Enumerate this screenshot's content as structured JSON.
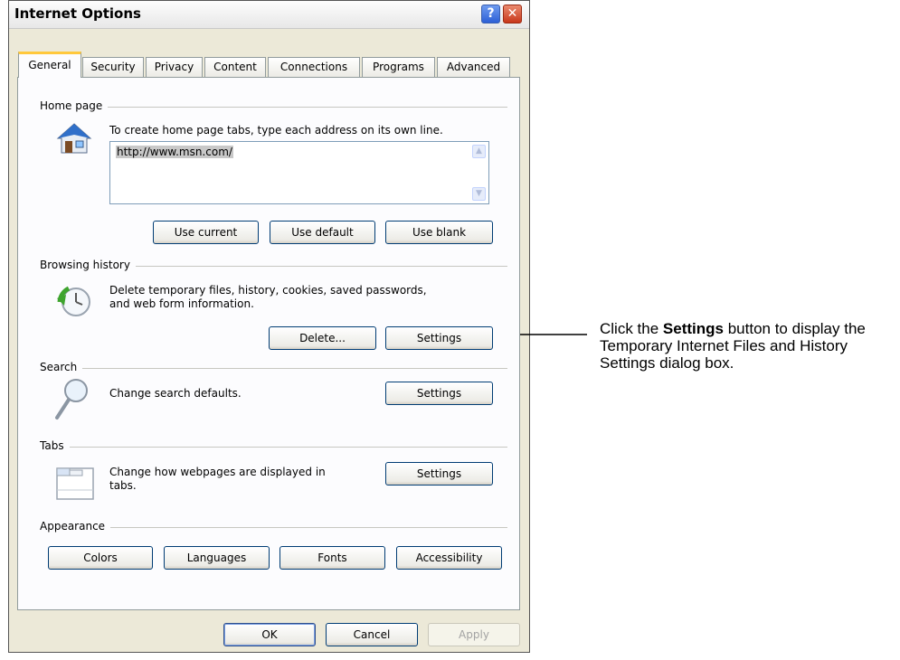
{
  "window": {
    "title": "Internet Options",
    "help_glyph": "?",
    "close_glyph": "✕"
  },
  "tabs": [
    {
      "label": "General",
      "active": true
    },
    {
      "label": "Security"
    },
    {
      "label": "Privacy"
    },
    {
      "label": "Content"
    },
    {
      "label": "Connections"
    },
    {
      "label": "Programs"
    },
    {
      "label": "Advanced"
    }
  ],
  "home_page": {
    "group_label": "Home page",
    "instructions": "To create home page tabs, type each address on its own line.",
    "value": "http://www.msn.com/",
    "buttons": [
      "Use current",
      "Use default",
      "Use blank"
    ],
    "icon": "house-icon"
  },
  "browsing_history": {
    "group_label": "Browsing history",
    "description_line1": "Delete temporary files, history, cookies, saved passwords,",
    "description_line2": "and web form information.",
    "delete_label": "Delete...",
    "settings_label": "Settings",
    "icon": "history-clock-icon"
  },
  "search": {
    "group_label": "Search",
    "description": "Change search defaults.",
    "settings_label": "Settings",
    "icon": "magnifier-icon"
  },
  "tabs_group": {
    "group_label": "Tabs",
    "description_line1": "Change how webpages are displayed in",
    "description_line2": "tabs.",
    "settings_label": "Settings",
    "icon": "tabbed-window-icon"
  },
  "appearance": {
    "group_label": "Appearance",
    "buttons": [
      "Colors",
      "Languages",
      "Fonts",
      "Accessibility"
    ]
  },
  "footer": {
    "ok": "OK",
    "cancel": "Cancel",
    "apply": "Apply"
  },
  "annotation": {
    "prefix": "Click the ",
    "bold": "Settings",
    "suffix": " button to display the Temporary Internet Files and History Settings dialog box."
  }
}
